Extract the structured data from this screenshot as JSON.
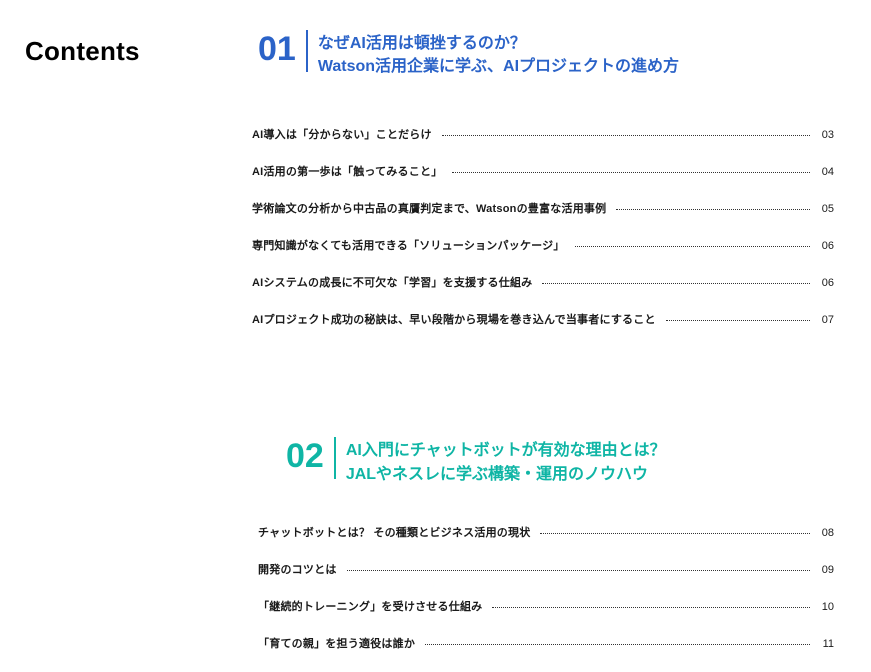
{
  "heading": "Contents",
  "sections": [
    {
      "number": "01",
      "color": "blue",
      "indent": false,
      "head_short": false,
      "title_line1": "なぜAI活用は頓挫するのか？",
      "title_line2": "Watson活用企業に学ぶ、AIプロジェクトの進め方",
      "items": [
        {
          "text": "AI導入は「分からない」ことだらけ",
          "page": "03"
        },
        {
          "text": "AI活用の第一歩は「触ってみること」",
          "page": "04"
        },
        {
          "text": "学術論文の分析から中古品の真贋判定まで、Watsonの豊富な活用事例",
          "page": "05"
        },
        {
          "text": "専門知識がなくても活用できる「ソリューションパッケージ」",
          "page": "06"
        },
        {
          "text": "AIシステムの成長に不可欠な「学習」を支援する仕組み",
          "page": "06"
        },
        {
          "text": "AIプロジェクト成功の秘訣は、早い段階から現場を巻き込んで当事者にすること",
          "page": "07"
        }
      ]
    },
    {
      "number": "02",
      "color": "teal",
      "indent": true,
      "head_short": true,
      "title_line1": "AI入門にチャットボットが有効な理由とは？",
      "title_line2": "JALやネスレに学ぶ構築・運用のノウハウ",
      "items": [
        {
          "text": "チャットボットとは？ その種類とビジネス活用の現状",
          "page": "08"
        },
        {
          "text": "開発のコツとは",
          "page": "09"
        },
        {
          "text": "「継続的トレーニング」を受けさせる仕組み",
          "page": "10"
        },
        {
          "text": "「育ての親」を担う適役は誰か",
          "page": "11"
        }
      ]
    }
  ]
}
